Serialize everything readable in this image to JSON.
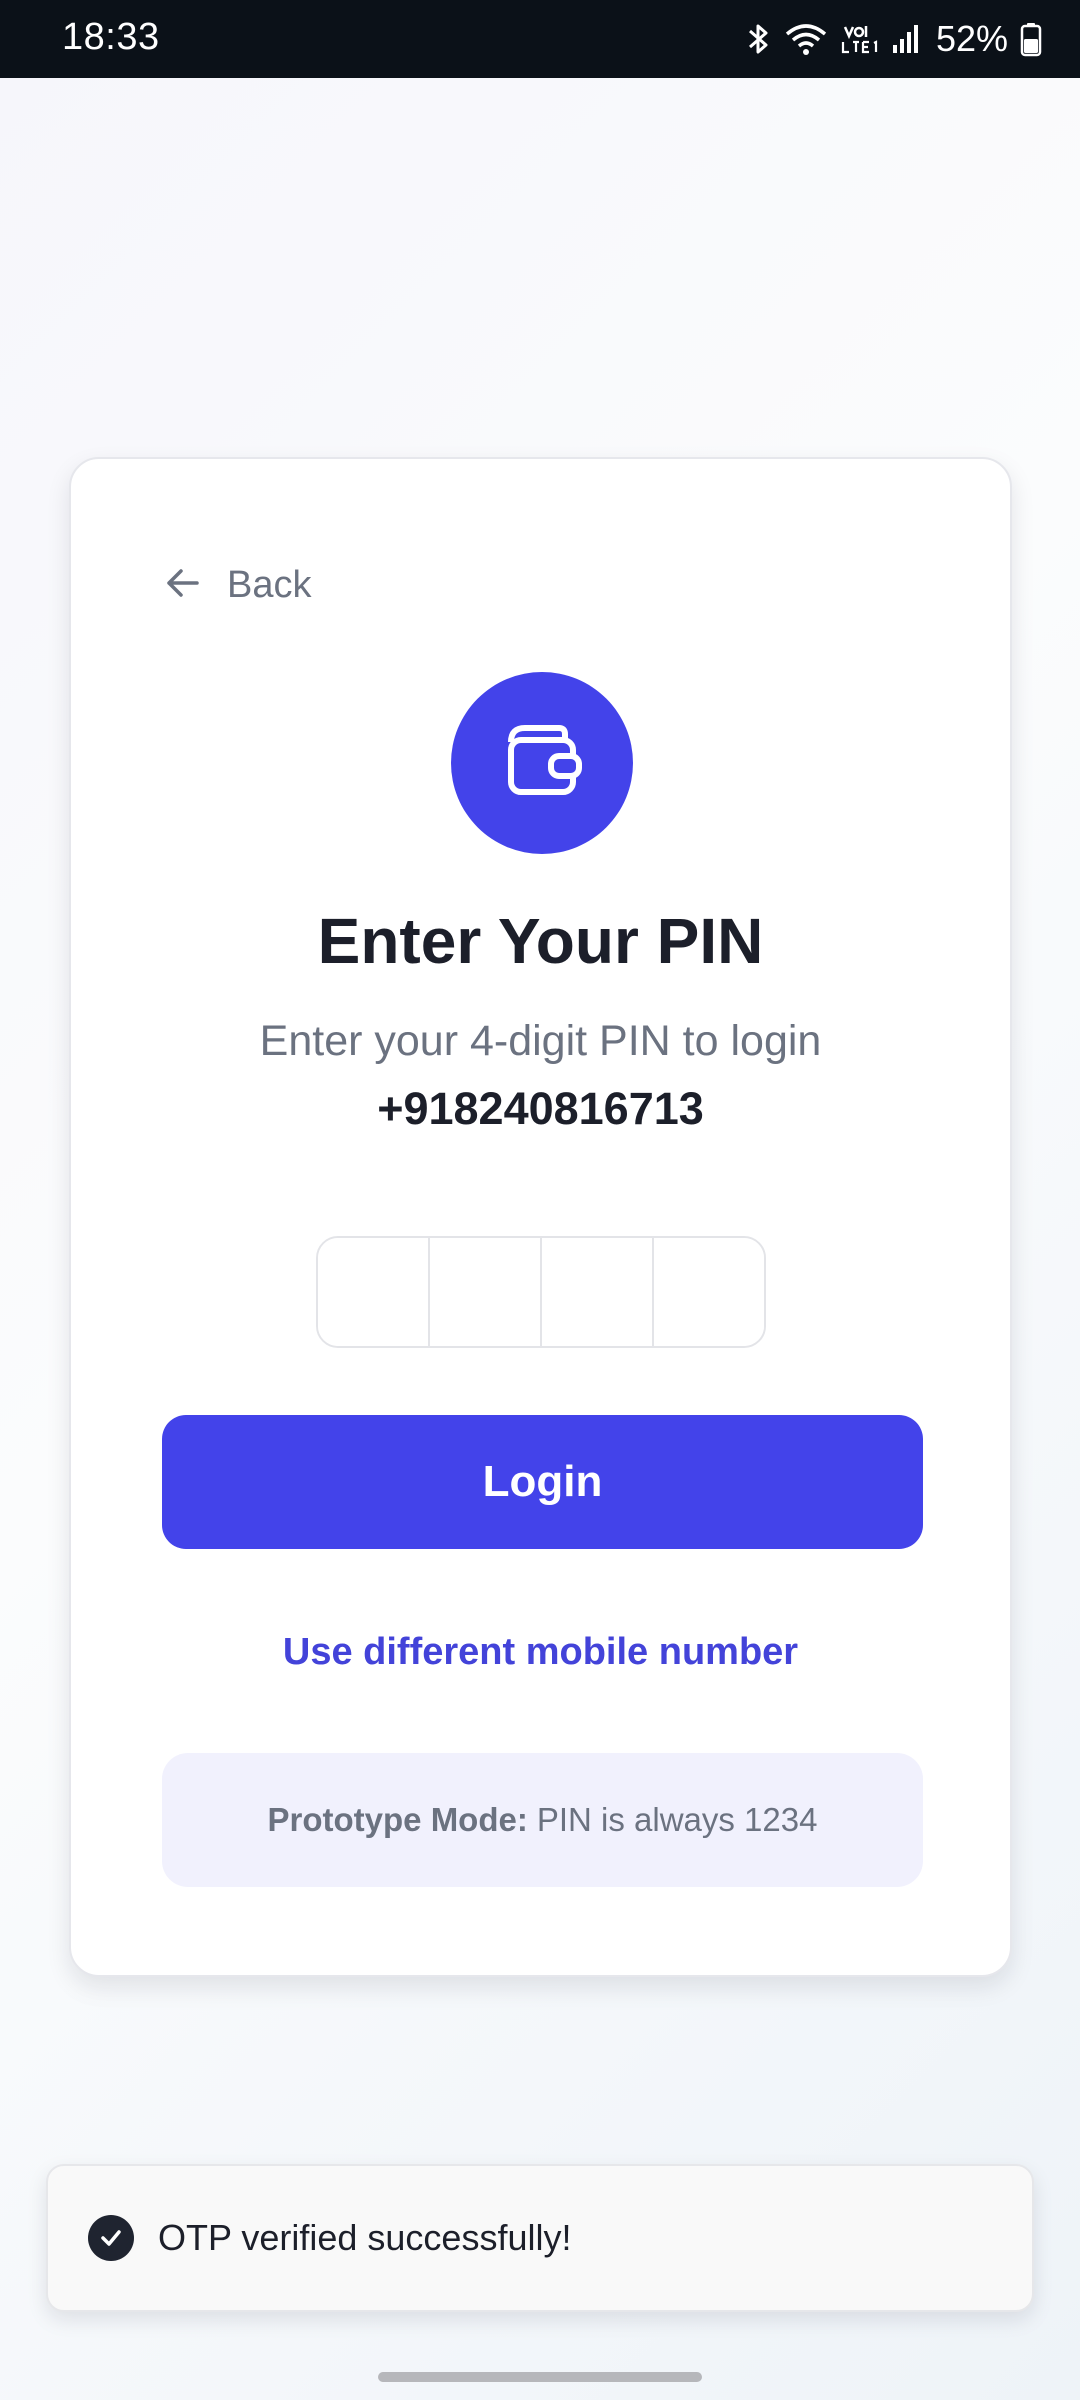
{
  "status_bar": {
    "time": "18:33",
    "battery": "52%",
    "icons": [
      "bluetooth-icon",
      "wifi-icon",
      "volte-icon",
      "signal-icon",
      "battery-icon"
    ]
  },
  "card": {
    "back_label": "Back",
    "icon": "wallet-icon",
    "title": "Enter Your PIN",
    "subtitle": "Enter your 4-digit PIN to login",
    "phone": "+918240816713",
    "pin_digits": [
      "",
      "",
      "",
      ""
    ],
    "login_label": "Login",
    "alt_link": "Use different mobile number",
    "prototype_label": "Prototype Mode:",
    "prototype_text": "PIN is always 1234"
  },
  "toast": {
    "message": "OTP verified successfully!",
    "icon": "check-circle-icon"
  },
  "colors": {
    "accent": "#4343ea",
    "status_bar": "#0b1118",
    "prototype_bg": "#f1f1fd"
  }
}
